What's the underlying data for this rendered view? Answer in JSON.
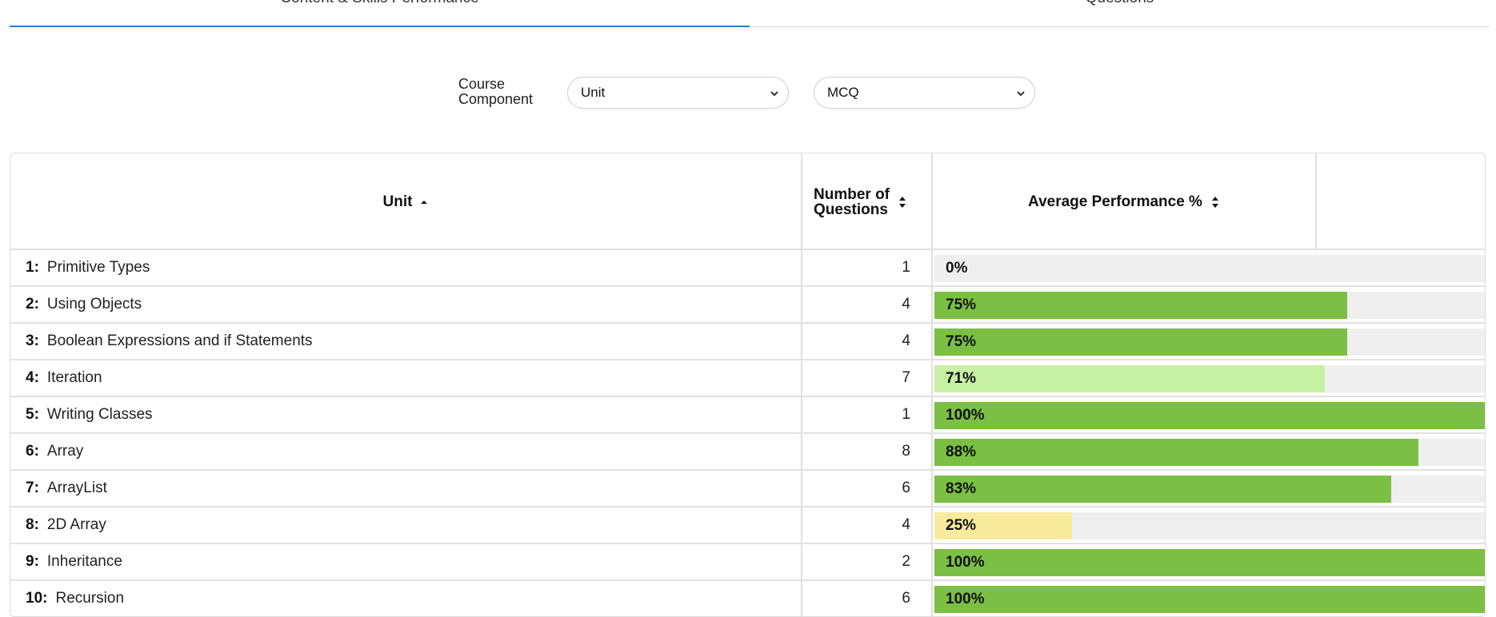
{
  "tabs": [
    {
      "label": "Content & Skills Performance",
      "active": true
    },
    {
      "label": "Questions",
      "active": false
    }
  ],
  "filters": {
    "label": "Course Component",
    "unit_select": "Unit",
    "type_select": "MCQ"
  },
  "table": {
    "headers": {
      "unit": "Unit",
      "count": "Number of Questions",
      "performance": "Average Performance %"
    },
    "rows": [
      {
        "num": "1:",
        "name": "Primitive Types",
        "count": "1",
        "percent_label": "0%",
        "percent": 0,
        "color": "#efefef"
      },
      {
        "num": "2:",
        "name": "Using Objects",
        "count": "4",
        "percent_label": "75%",
        "percent": 75,
        "color": "#7cbf45"
      },
      {
        "num": "3:",
        "name": "Boolean Expressions and if Statements",
        "count": "4",
        "percent_label": "75%",
        "percent": 75,
        "color": "#7cbf45"
      },
      {
        "num": "4:",
        "name": "Iteration",
        "count": "7",
        "percent_label": "71%",
        "percent": 71,
        "color": "#c6f1a3"
      },
      {
        "num": "5:",
        "name": "Writing Classes",
        "count": "1",
        "percent_label": "100%",
        "percent": 100,
        "color": "#7cbf45"
      },
      {
        "num": "6:",
        "name": "Array",
        "count": "8",
        "percent_label": "88%",
        "percent": 88,
        "color": "#7cbf45"
      },
      {
        "num": "7:",
        "name": "ArrayList",
        "count": "6",
        "percent_label": "83%",
        "percent": 83,
        "color": "#7cbf45"
      },
      {
        "num": "8:",
        "name": "2D Array",
        "count": "4",
        "percent_label": "25%",
        "percent": 25,
        "color": "#f9eb9c"
      },
      {
        "num": "9:",
        "name": "Inheritance",
        "count": "2",
        "percent_label": "100%",
        "percent": 100,
        "color": "#7cbf45"
      },
      {
        "num": "10:",
        "name": "Recursion",
        "count": "6",
        "percent_label": "100%",
        "percent": 100,
        "color": "#7cbf45"
      }
    ]
  }
}
